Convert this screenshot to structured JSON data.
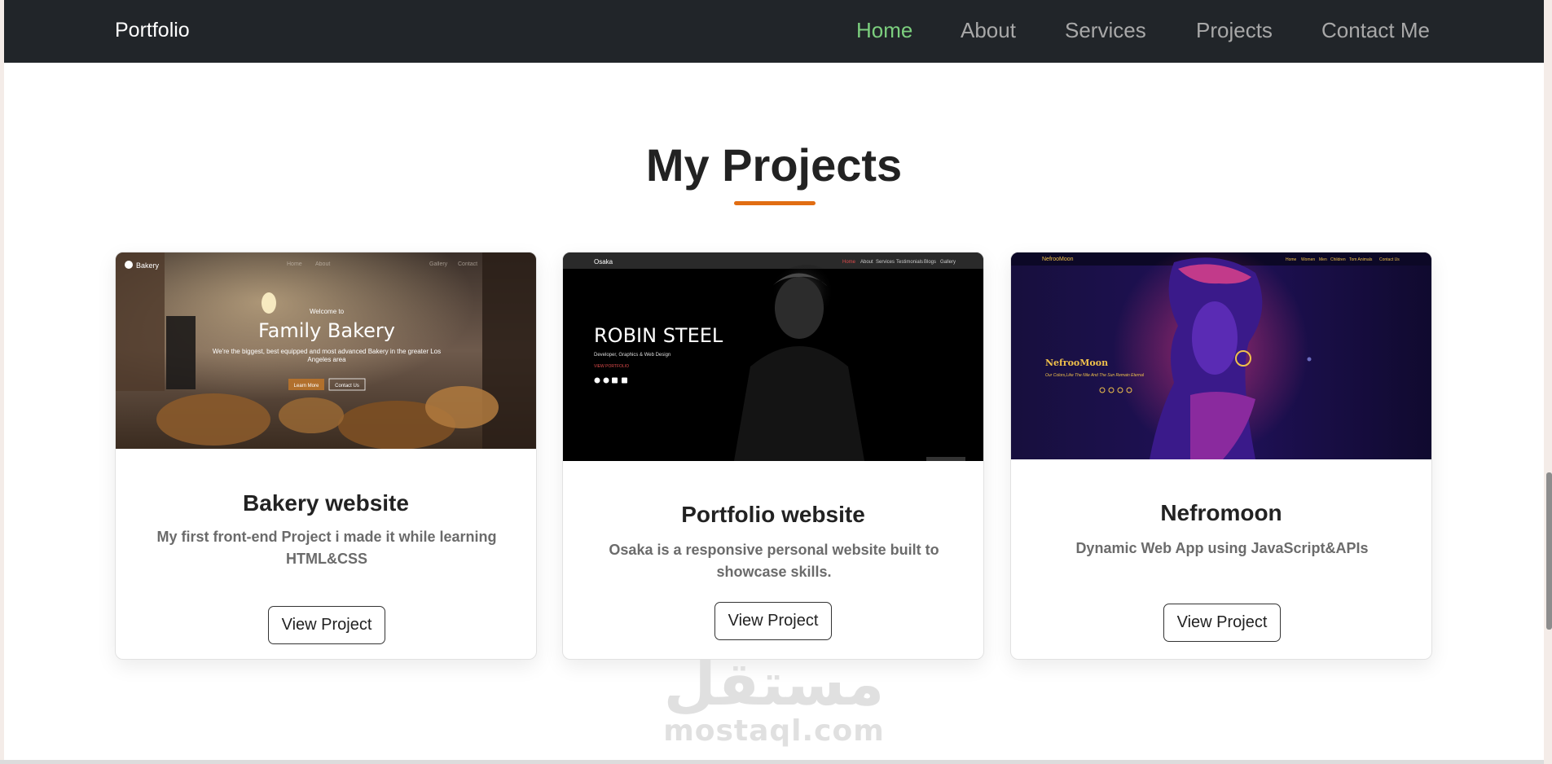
{
  "navbar": {
    "brand": "Portfolio",
    "links": [
      {
        "label": "Home",
        "active": true
      },
      {
        "label": "About",
        "active": false
      },
      {
        "label": "Services",
        "active": false
      },
      {
        "label": "Projects",
        "active": false
      },
      {
        "label": "Contact Me",
        "active": false
      }
    ]
  },
  "section": {
    "title": "My Projects",
    "accent_color": "#e16d12"
  },
  "projects": [
    {
      "title": "Bakery website",
      "description": "My first front-end Project i made it while learning HTML&CSS",
      "button": "View Project",
      "screenshot": {
        "logo": "Bakery",
        "nav": [
          "Home",
          "About",
          "Gallery",
          "Contact"
        ],
        "welcome": "Welcome to",
        "headline": "Family Bakery",
        "tagline": "We're the biggest, best equipped and most advanced Bakery in the greater Los Angeles area",
        "btn_primary": "Learn More",
        "btn_secondary": "Contact Us"
      }
    },
    {
      "title": "Portfolio website",
      "description": "Osaka is a responsive personal website built to showcase skills.",
      "button": "View Project",
      "screenshot": {
        "logo": "Osaka",
        "nav": [
          "Home",
          "About",
          "Services",
          "Testimonials",
          "Blogs",
          "Gallery"
        ],
        "headline": "ROBIN STEEL",
        "subtitle": "Developer, Graphics & Web Design",
        "cta": "VIEW PORTFOLIO"
      }
    },
    {
      "title": "Nefromoon",
      "description": "Dynamic Web App using JavaScript&APIs",
      "button": "View Project",
      "screenshot": {
        "logo": "NefrooMoon",
        "nav": [
          "Home",
          "Women",
          "Men",
          "Children",
          "Tom Animals",
          "Contact Us"
        ],
        "headline": "NefrooMoon",
        "subtitle": "Our Colors,Like The Nile And The Sun Remain Eternal"
      }
    }
  ],
  "watermark": {
    "arabic": "مستقل",
    "latin": "mostaql.com"
  },
  "icons": [
    "chef-hat-icon",
    "facebook-icon",
    "twitter-icon",
    "instagram-icon",
    "linkedin-icon"
  ]
}
